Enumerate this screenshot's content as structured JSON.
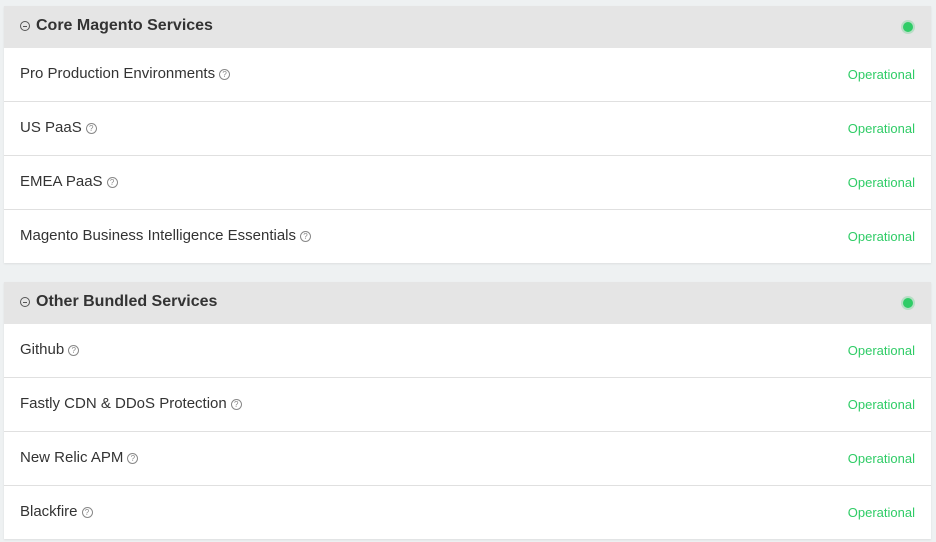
{
  "colors": {
    "operational": "#2fcc66",
    "header_bg": "#e5e5e5",
    "page_bg": "#eef1f2"
  },
  "groups": [
    {
      "title": "Core Magento Services",
      "components": [
        {
          "name": "Pro Production Environments",
          "status": "Operational"
        },
        {
          "name": "US PaaS",
          "status": "Operational"
        },
        {
          "name": "EMEA PaaS",
          "status": "Operational"
        },
        {
          "name": "Magento Business Intelligence Essentials",
          "status": "Operational"
        }
      ]
    },
    {
      "title": "Other Bundled Services",
      "components": [
        {
          "name": "Github",
          "status": "Operational"
        },
        {
          "name": "Fastly CDN & DDoS Protection",
          "status": "Operational"
        },
        {
          "name": "New Relic APM",
          "status": "Operational"
        },
        {
          "name": "Blackfire",
          "status": "Operational"
        }
      ]
    }
  ],
  "icons": {
    "collapse": "minus-circle-icon",
    "help": "question-circle-icon",
    "status": "status-dot-icon"
  }
}
